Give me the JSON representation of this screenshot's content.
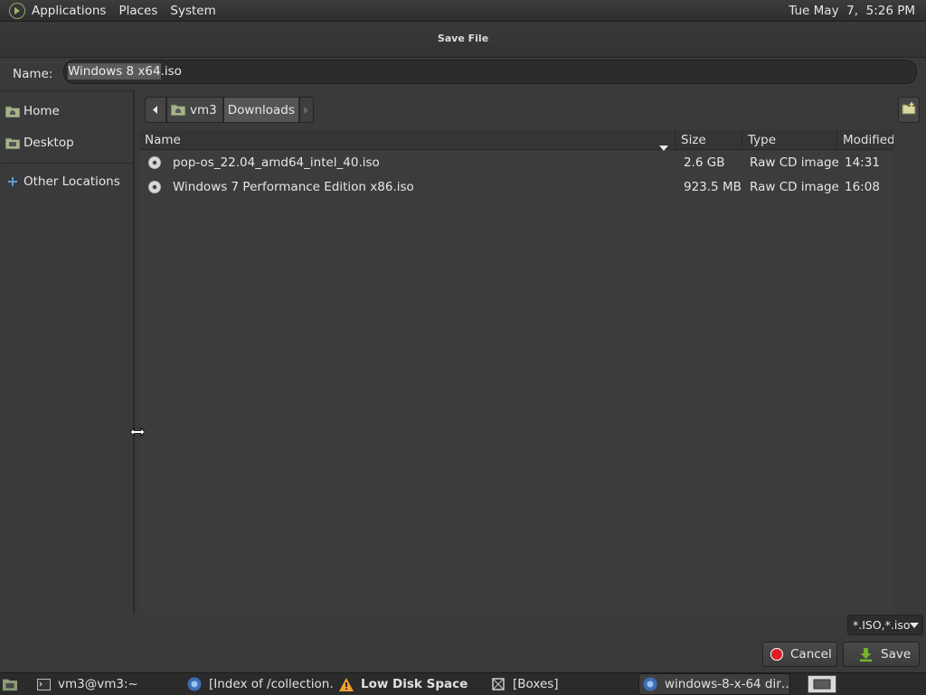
{
  "top_panel": {
    "menus": [
      "Applications",
      "Places",
      "System"
    ],
    "clock": "Tue May  7,  5:26 PM"
  },
  "dialog": {
    "title": "Save File",
    "name_label": "Name:",
    "name_value": "Windows 8 x64.iso",
    "name_selected": "Windows 8 x64",
    "name_rest": ".iso",
    "sidebar": [
      {
        "label": "Home",
        "icon": "home-folder-icon"
      },
      {
        "label": "Desktop",
        "icon": "desktop-folder-icon"
      },
      {
        "label": "Other Locations",
        "icon": "plus-icon"
      }
    ],
    "path": [
      "vm3",
      "Downloads"
    ],
    "columns": [
      "Name",
      "Size",
      "Type",
      "Modified"
    ],
    "files": [
      {
        "name": "pop-os_22.04_amd64_intel_40.iso",
        "size": "2.6 GB",
        "type": "Raw CD image",
        "modified": "14:31"
      },
      {
        "name": "Windows 7 Performance Edition x86.iso",
        "size": "923.5 MB",
        "type": "Raw CD image",
        "modified": "16:08"
      }
    ],
    "filter": "*.ISO,*.iso",
    "cancel_label": "Cancel",
    "save_label": "Save"
  },
  "taskbar": {
    "tasks": [
      {
        "label": "vm3@vm3:~",
        "icon": "terminal-icon"
      },
      {
        "label": "[Index of /collection…",
        "icon": "browser-icon"
      },
      {
        "label": "Low Disk Space",
        "icon": "warning-icon"
      },
      {
        "label": "[Boxes]",
        "icon": "boxes-icon"
      },
      {
        "label": "windows-8-x-64 dir…",
        "icon": "browser-icon"
      }
    ]
  },
  "colors": {
    "accent_red": "#e01b24",
    "save_green": "#73b32d",
    "folder_tint": "#a5b58a"
  }
}
